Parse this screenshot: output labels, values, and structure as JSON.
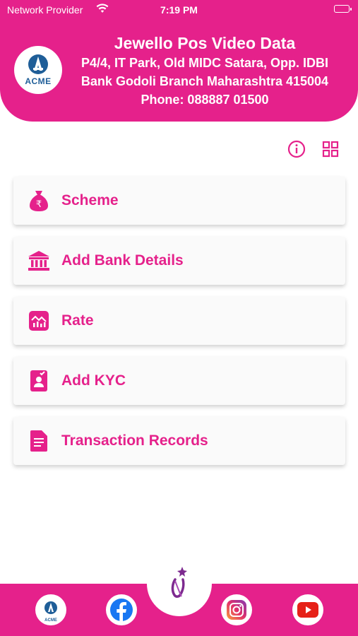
{
  "status_bar": {
    "carrier": "Network Provider",
    "time": "7:19 PM"
  },
  "header": {
    "logo_text": "ACME",
    "company_name": "Jewello Pos Video Data",
    "address_line1": "P4/4, IT Park, Old MIDC Satara, Opp. IDBI",
    "address_line2": "Bank Godoli Branch Maharashtra 415004",
    "phone": "Phone: 088887 01500"
  },
  "menu": [
    {
      "label": "Scheme",
      "icon": "money-bag-icon"
    },
    {
      "label": "Add Bank Details",
      "icon": "bank-icon"
    },
    {
      "label": "Rate",
      "icon": "chart-icon"
    },
    {
      "label": "Add KYC",
      "icon": "id-card-icon"
    },
    {
      "label": "Transaction Records",
      "icon": "document-icon"
    }
  ],
  "bottom_bar": {
    "logo_text": "ACME",
    "items": [
      "acme-logo",
      "facebook-icon",
      "app-logo",
      "instagram-icon",
      "youtube-icon"
    ]
  },
  "colors": {
    "primary": "#e5218b",
    "card_bg": "#fafafa",
    "background": "#ffffff"
  }
}
